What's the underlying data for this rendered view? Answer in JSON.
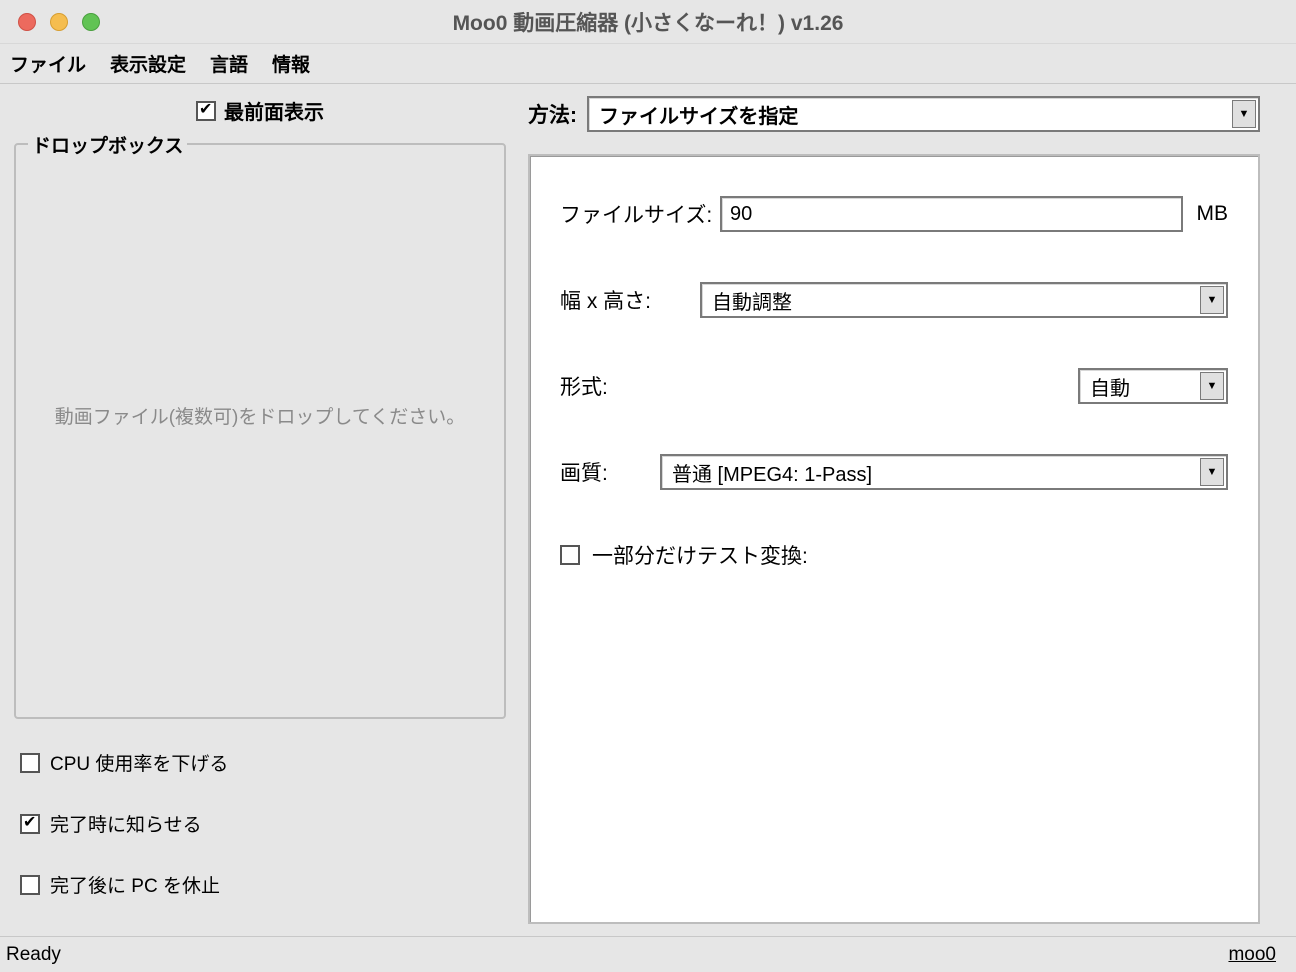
{
  "window": {
    "title": "Moo0 動画圧縮器 (小さくなーれ！) v1.26"
  },
  "menu": {
    "file": "ファイル",
    "display": "表示設定",
    "language": "言語",
    "info": "情報"
  },
  "left": {
    "topmost": "最前面表示",
    "dropbox_legend": "ドロップボックス",
    "drop_placeholder": "動画ファイル(複数可)をドロップしてください。",
    "cpu_lower": "CPU 使用率を下げる",
    "notify_done": "完了時に知らせる",
    "sleep_after": "完了後に PC を休止"
  },
  "right": {
    "method_label": "方法:",
    "method_value": "ファイルサイズを指定",
    "filesize_label": "ファイルサイズ:",
    "filesize_value": "90",
    "filesize_unit": "MB",
    "dimensions_label": "幅 x 高さ:",
    "dimensions_value": "自動調整",
    "format_label": "形式:",
    "format_value": "自動",
    "quality_label": "画質:",
    "quality_value": "普通  [MPEG4: 1-Pass]",
    "test_label": "一部分だけテスト変換:"
  },
  "status": {
    "ready": "Ready",
    "link": "moo0"
  },
  "checked": {
    "topmost": true,
    "cpu_lower": false,
    "notify_done": true,
    "sleep_after": false,
    "test": false
  }
}
